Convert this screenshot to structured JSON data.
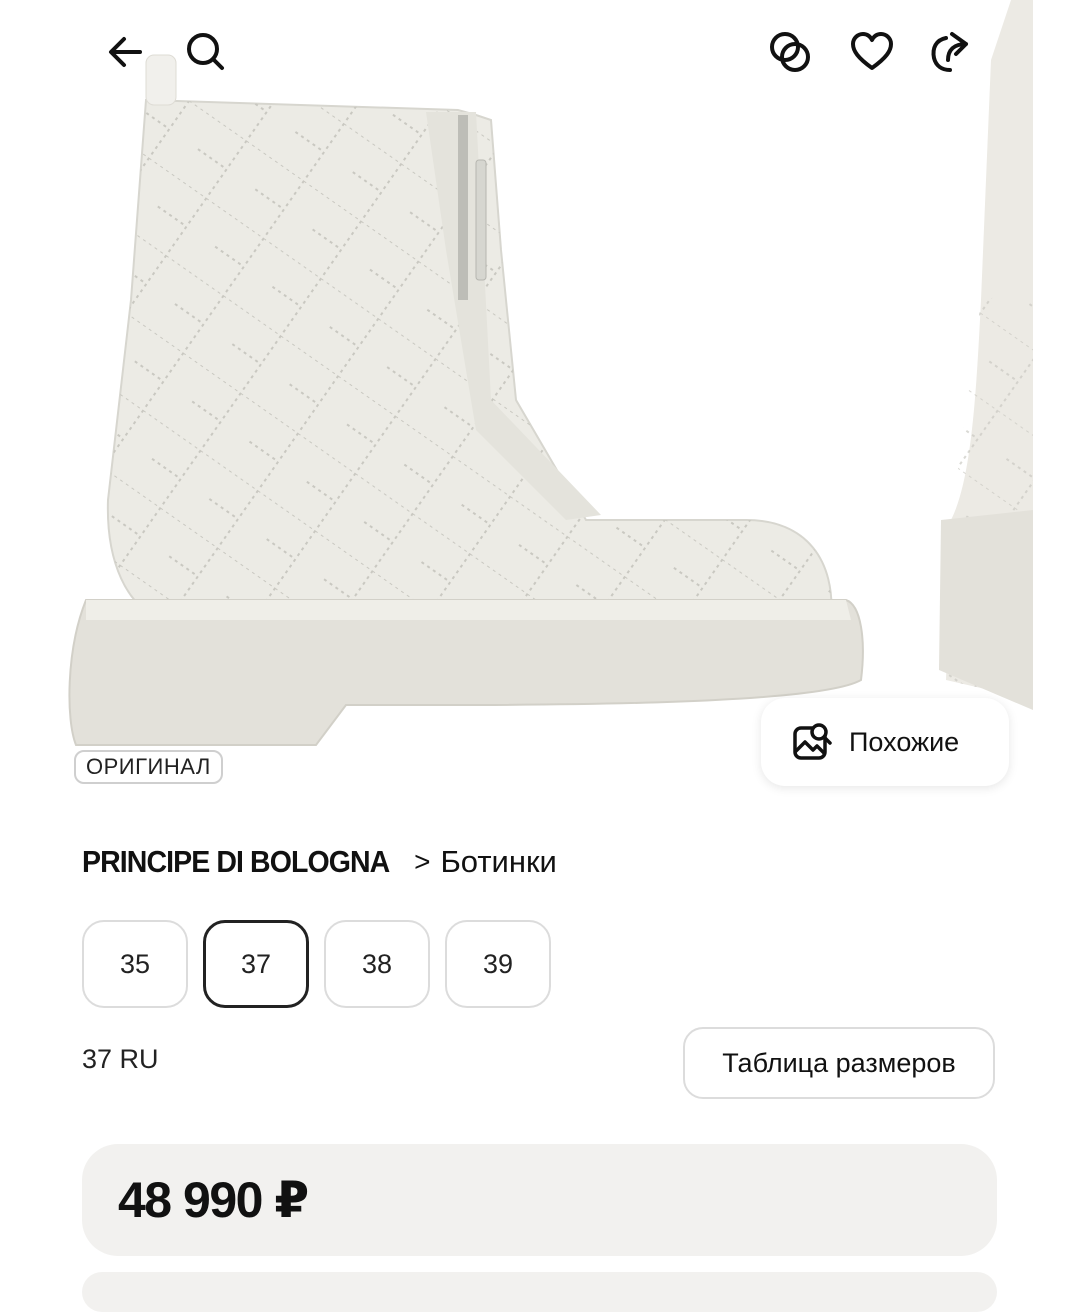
{
  "header": {
    "back_icon": "arrow-left-icon",
    "search_icon": "search-icon",
    "compare_icon": "compare-circles-icon",
    "favorite_icon": "heart-icon",
    "share_icon": "share-icon"
  },
  "gallery": {
    "badge": "ОРИГИНАЛ",
    "similar_label": "Похожие",
    "similar_icon": "image-search-icon"
  },
  "product": {
    "brand": "PRINCIPE DI BOLOGNA",
    "separator": ">",
    "category": "Ботинки"
  },
  "sizes": {
    "options": [
      "35",
      "37",
      "38",
      "39"
    ],
    "selected": "37",
    "selected_hint": "37 RU",
    "table_button": "Таблица размеров"
  },
  "price": {
    "value": "48 990 ₽"
  },
  "colors": {
    "boot": "#ecebe5",
    "sole": "#e3e1da",
    "card": "#f2f1ef"
  }
}
